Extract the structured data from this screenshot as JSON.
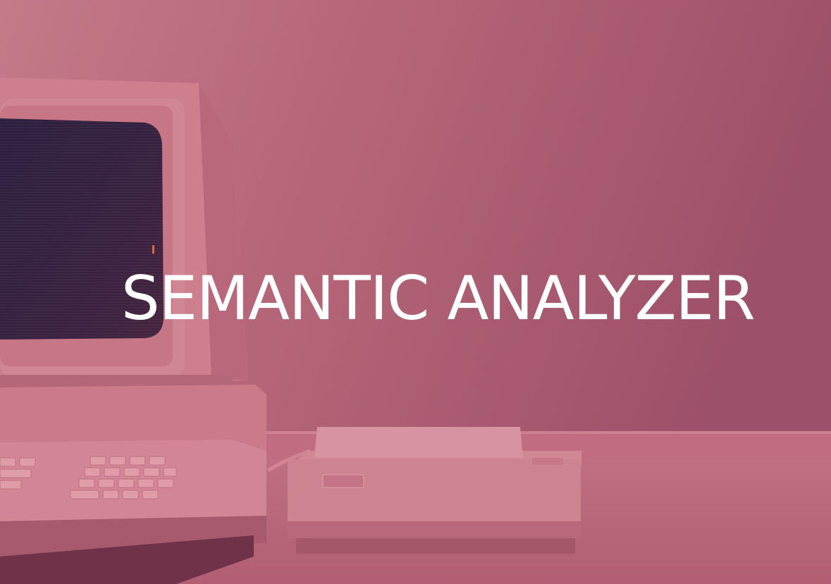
{
  "hero": {
    "title": "SEMANTIC ANALYZER"
  },
  "colors": {
    "overlay": "#b4667a",
    "title_text": "#ffffff",
    "screen": "#2a1a3a"
  },
  "image": {
    "subject": "retro-computer-and-printer"
  }
}
